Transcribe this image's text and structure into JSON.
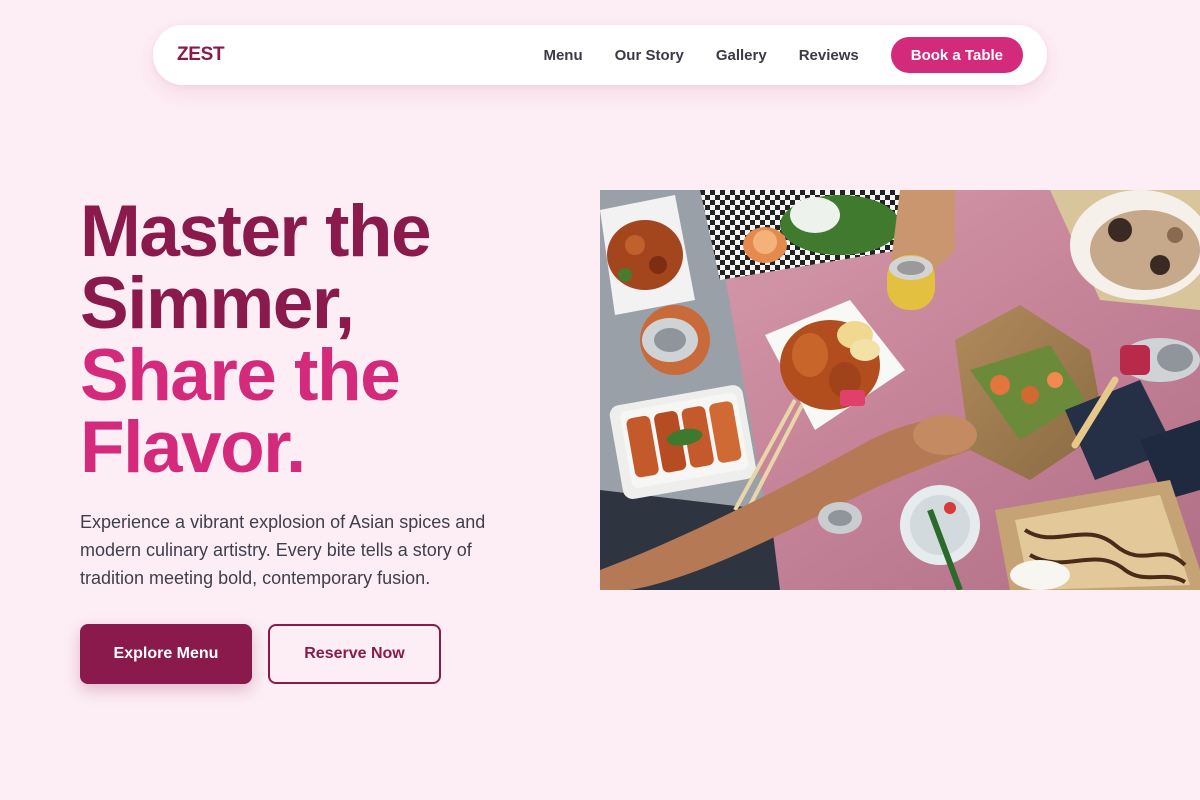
{
  "brand": {
    "name": "ZEST"
  },
  "nav": {
    "links": [
      {
        "label": "Menu"
      },
      {
        "label": "Our Story"
      },
      {
        "label": "Gallery"
      },
      {
        "label": "Reviews"
      }
    ],
    "cta_label": "Book a Table"
  },
  "hero": {
    "headline": {
      "line1": "Master the",
      "line2": "Simmer,",
      "line3": "Share the",
      "line4": "Flavor."
    },
    "description": "Experience a vibrant explosion of Asian spices and modern culinary artistry. Every bite tells a story of tradition meeting bold, contemporary fusion.",
    "primary_button": "Explore Menu",
    "secondary_button": "Reserve Now",
    "image_subject": "overhead photo of Asian street food spread on pink table"
  },
  "colors": {
    "background": "#fdeef5",
    "brand_dark": "#8a1a4c",
    "brand_pink": "#d42a7c",
    "text": "#3f3f4c"
  }
}
